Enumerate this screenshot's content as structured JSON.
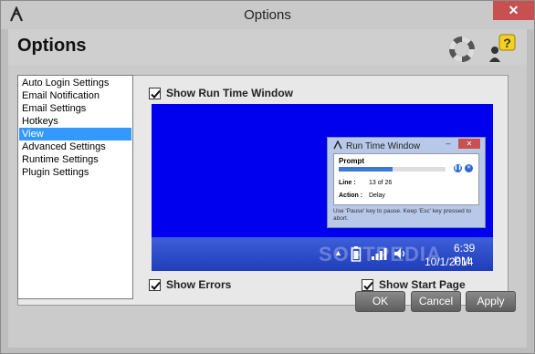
{
  "window": {
    "title": "Options",
    "close_label": "✕"
  },
  "header": {
    "title": "Options"
  },
  "nav": {
    "items": [
      {
        "label": "Auto Login Settings"
      },
      {
        "label": "Email Notification"
      },
      {
        "label": "Email Settings"
      },
      {
        "label": "Hotkeys"
      },
      {
        "label": "View",
        "selected": true
      },
      {
        "label": "Advanced Settings"
      },
      {
        "label": "Runtime Settings"
      },
      {
        "label": "Plugin Settings"
      }
    ]
  },
  "view": {
    "show_run_time_window": {
      "label": "Show Run Time Window",
      "checked": true
    },
    "show_errors": {
      "label": "Show Errors",
      "checked": true
    },
    "show_start_page": {
      "label": "Show Start Page",
      "checked": true
    }
  },
  "preview": {
    "run_time_window": {
      "title": "Run Time Window",
      "min_label": "–",
      "max_label": "□",
      "close_label": "✕",
      "prompt_label": "Prompt",
      "progress_fraction": 0.5,
      "line_label": "Line :",
      "line_value": "13 of 26",
      "action_label": "Action :",
      "action_value": "Delay",
      "hint": "Use 'Pause' key to pause. Keep 'Esc' key pressed to abort."
    },
    "taskbar": {
      "time": "6:39 PM",
      "date": "10/1/2014",
      "watermark": "SOFTPEDIA",
      "tray_arrow": "▲"
    },
    "desktop_color": "#0000ee"
  },
  "footer": {
    "ok_label": "OK",
    "cancel_label": "Cancel",
    "apply_label": "Apply"
  },
  "colors": {
    "selection": "#3399ff",
    "close": "#c75050",
    "button": "#6e6e6e"
  }
}
